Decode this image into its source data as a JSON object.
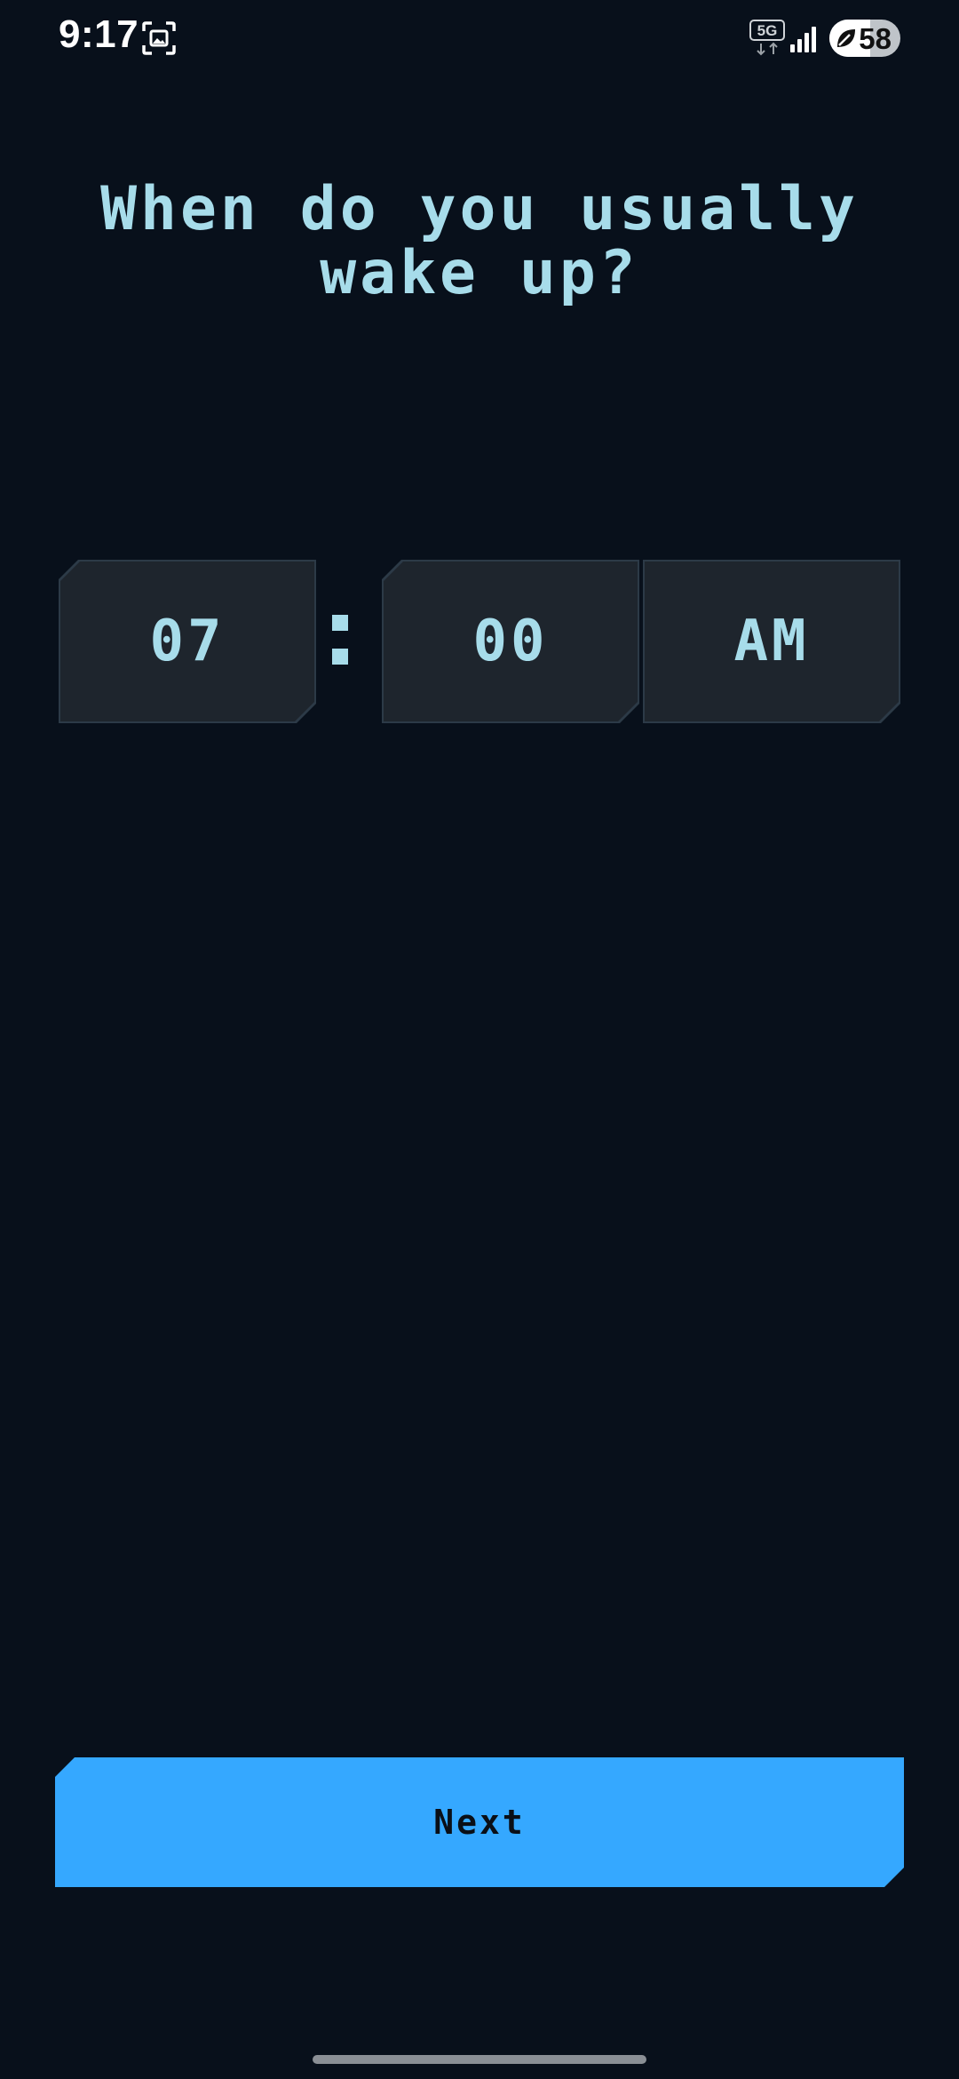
{
  "status_bar": {
    "time": "9:17",
    "network_label": "5G",
    "battery_level": "58",
    "battery_fraction": 0.58,
    "icons": [
      "screenshot-icon",
      "network-5g-icon",
      "signal-icon",
      "battery-saver-leaf-icon"
    ]
  },
  "title": "When do you usually wake up?",
  "picker": {
    "hour": "07",
    "separator": ":",
    "minute": "00",
    "period": "AM"
  },
  "next_button": {
    "label": "Next"
  },
  "colors": {
    "background": "#08101b",
    "text_accent": "#a7dcea",
    "picker_box": "#1e252d",
    "picker_border": "#2c3a47",
    "primary_button": "#35a8ff"
  }
}
